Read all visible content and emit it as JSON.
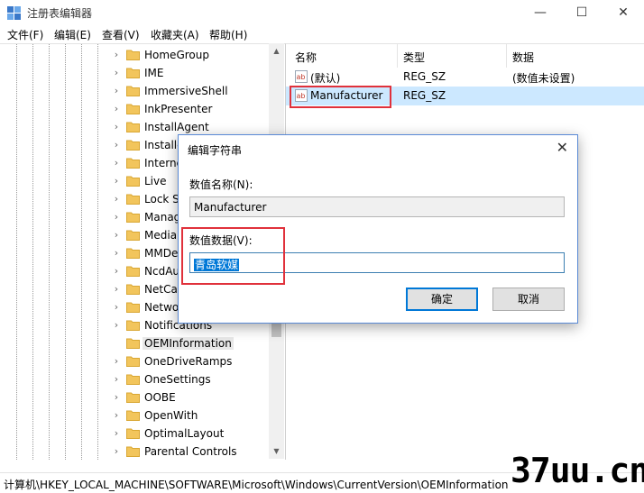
{
  "window": {
    "title": "注册表编辑器",
    "minimize": "—",
    "maximize": "☐",
    "close": "✕"
  },
  "menu": [
    "文件(F)",
    "编辑(E)",
    "查看(V)",
    "收藏夹(A)",
    "帮助(H)"
  ],
  "tree": {
    "items": [
      {
        "label": "HomeGroup"
      },
      {
        "label": "IME"
      },
      {
        "label": "ImmersiveShell"
      },
      {
        "label": "InkPresenter"
      },
      {
        "label": "InstallAgent"
      },
      {
        "label": "Installe"
      },
      {
        "label": "Interne"
      },
      {
        "label": "Live"
      },
      {
        "label": "Lock S"
      },
      {
        "label": "Manag"
      },
      {
        "label": "Media"
      },
      {
        "label": "MMDe"
      },
      {
        "label": "NcdAu"
      },
      {
        "label": "NetCa"
      },
      {
        "label": "Netwo"
      },
      {
        "label": "Notifications"
      },
      {
        "label": "OEMInformation",
        "selected": true
      },
      {
        "label": "OneDriveRamps"
      },
      {
        "label": "OneSettings"
      },
      {
        "label": "OOBE"
      },
      {
        "label": "OpenWith"
      },
      {
        "label": "OptimalLayout"
      },
      {
        "label": "Parental Controls"
      }
    ]
  },
  "values": {
    "columns": [
      "名称",
      "类型",
      "数据"
    ],
    "rows": [
      {
        "name": "(默认)",
        "type": "REG_SZ",
        "data": "(数值未设置)"
      },
      {
        "name": "Manufacturer",
        "type": "REG_SZ",
        "data": "",
        "selected": true
      }
    ]
  },
  "dialog": {
    "title": "编辑字符串",
    "close": "✕",
    "name_label": "数值名称(N):",
    "name_value": "Manufacturer",
    "data_label": "数值数据(V):",
    "data_value": "青岛软媒",
    "ok": "确定",
    "cancel": "取消"
  },
  "status": {
    "path": "计算机\\HKEY_LOCAL_MACHINE\\SOFTWARE\\Microsoft\\Windows\\CurrentVersion\\OEMInformation"
  },
  "watermark": "37uu.cn",
  "colors": {
    "highlight": "#cce8ff",
    "selection": "#0078d7",
    "annotation": "#e0313b",
    "folder": "#f2c55c"
  }
}
